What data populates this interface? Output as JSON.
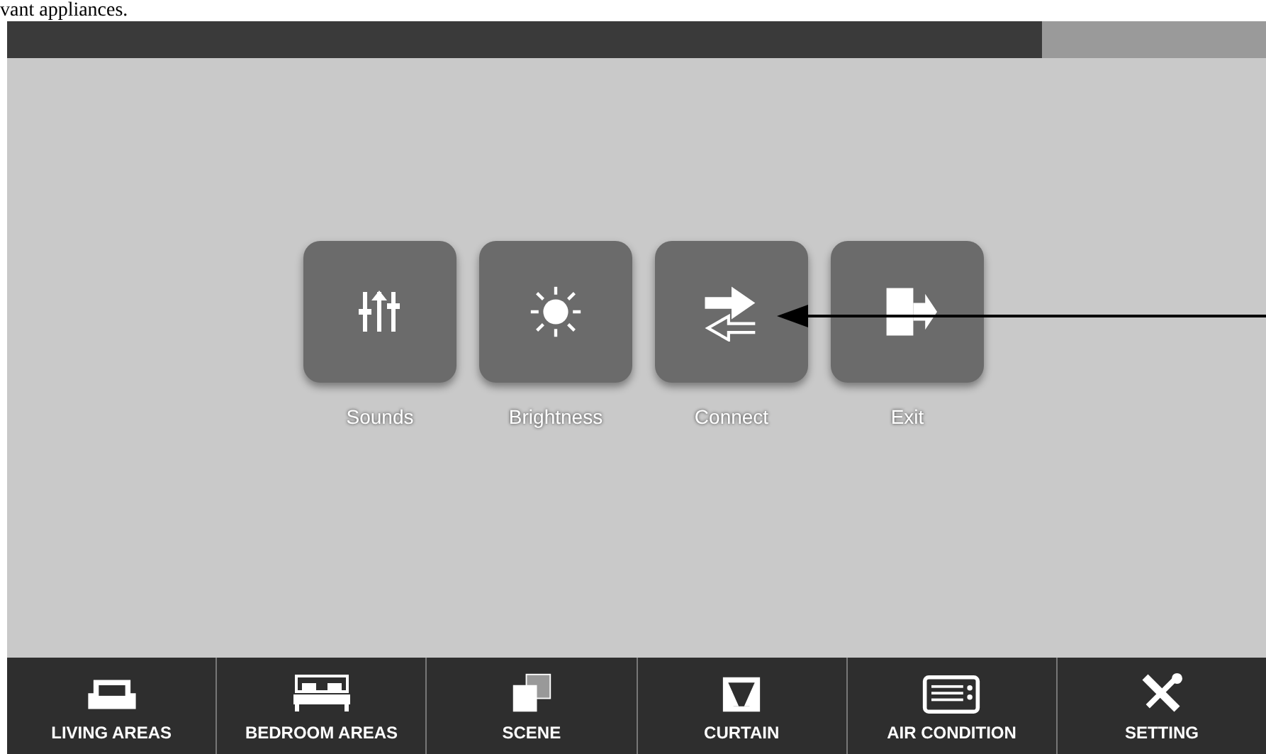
{
  "caption": "vant appliances.",
  "menu": [
    {
      "label": "Sounds"
    },
    {
      "label": "Brightness"
    },
    {
      "label": "Connect"
    },
    {
      "label": "Exit"
    }
  ],
  "tab_bar": [
    {
      "label": "LIVING AREAS"
    },
    {
      "label": "BEDROOM AREAS"
    },
    {
      "label": "SCENE"
    },
    {
      "label": "CURTAIN"
    },
    {
      "label": "AIR CONDITION"
    },
    {
      "label": "SETTING"
    }
  ]
}
